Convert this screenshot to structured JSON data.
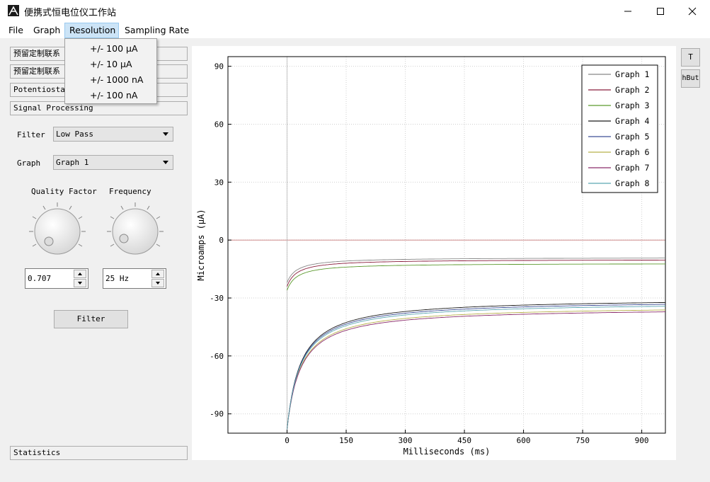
{
  "window": {
    "title": "便携式恒电位仪工作站"
  },
  "menubar": {
    "items": [
      {
        "label": "File"
      },
      {
        "label": "Graph"
      },
      {
        "label": "Resolution"
      },
      {
        "label": "Sampling Rate"
      }
    ]
  },
  "resolution_menu": {
    "items": [
      {
        "label": "+/- 100 µA"
      },
      {
        "label": "+/- 10 µA"
      },
      {
        "label": "+/- 1000 nA"
      },
      {
        "label": "+/- 100 nA"
      }
    ]
  },
  "left_panel": {
    "sections": [
      {
        "label": "预留定制联系"
      },
      {
        "label": "预留定制联系"
      },
      {
        "label": "Potentiostat"
      },
      {
        "label": "Signal Processing"
      }
    ],
    "filter_label": "Filter",
    "filter_value": "Low Pass",
    "graph_label": "Graph",
    "graph_value": "Graph 1",
    "quality_label": "Quality Factor",
    "frequency_label": "Frequency",
    "quality_value": "0.707",
    "frequency_value": "25 Hz",
    "filter_button": "Filter",
    "statistics_label": "Statistics"
  },
  "right_buttons": [
    {
      "label": "T"
    },
    {
      "label": "hBut"
    }
  ],
  "colors": {
    "series": [
      "#888888",
      "#8a1e3c",
      "#5c9a2e",
      "#1a1a1a",
      "#3d4f96",
      "#b8b04a",
      "#8a2a6a",
      "#5aa6b2"
    ],
    "zero_line": "#c87a7a"
  },
  "chart_data": {
    "type": "line",
    "xlabel": "Milliseconds (ms)",
    "ylabel": "Microamps (µA)",
    "xlim": [
      -150,
      960
    ],
    "ylim": [
      -100,
      95
    ],
    "xticks": [
      0,
      150,
      300,
      450,
      600,
      750,
      900
    ],
    "yticks": [
      90,
      60,
      30,
      0,
      -30,
      -60,
      -90
    ],
    "grid": true,
    "legend_position": "top-right",
    "series": [
      {
        "name": "Graph 1",
        "y0": -22,
        "yend": -9
      },
      {
        "name": "Graph 2",
        "y0": -24,
        "yend": -10
      },
      {
        "name": "Graph 3",
        "y0": -26,
        "yend": -12
      },
      {
        "name": "Graph 4",
        "y0": -98,
        "yend": -30
      },
      {
        "name": "Graph 5",
        "y0": -98,
        "yend": -31
      },
      {
        "name": "Graph 6",
        "y0": -98,
        "yend": -34
      },
      {
        "name": "Graph 7",
        "y0": -98,
        "yend": -35
      },
      {
        "name": "Graph 8",
        "y0": -98,
        "yend": -32
      }
    ]
  }
}
